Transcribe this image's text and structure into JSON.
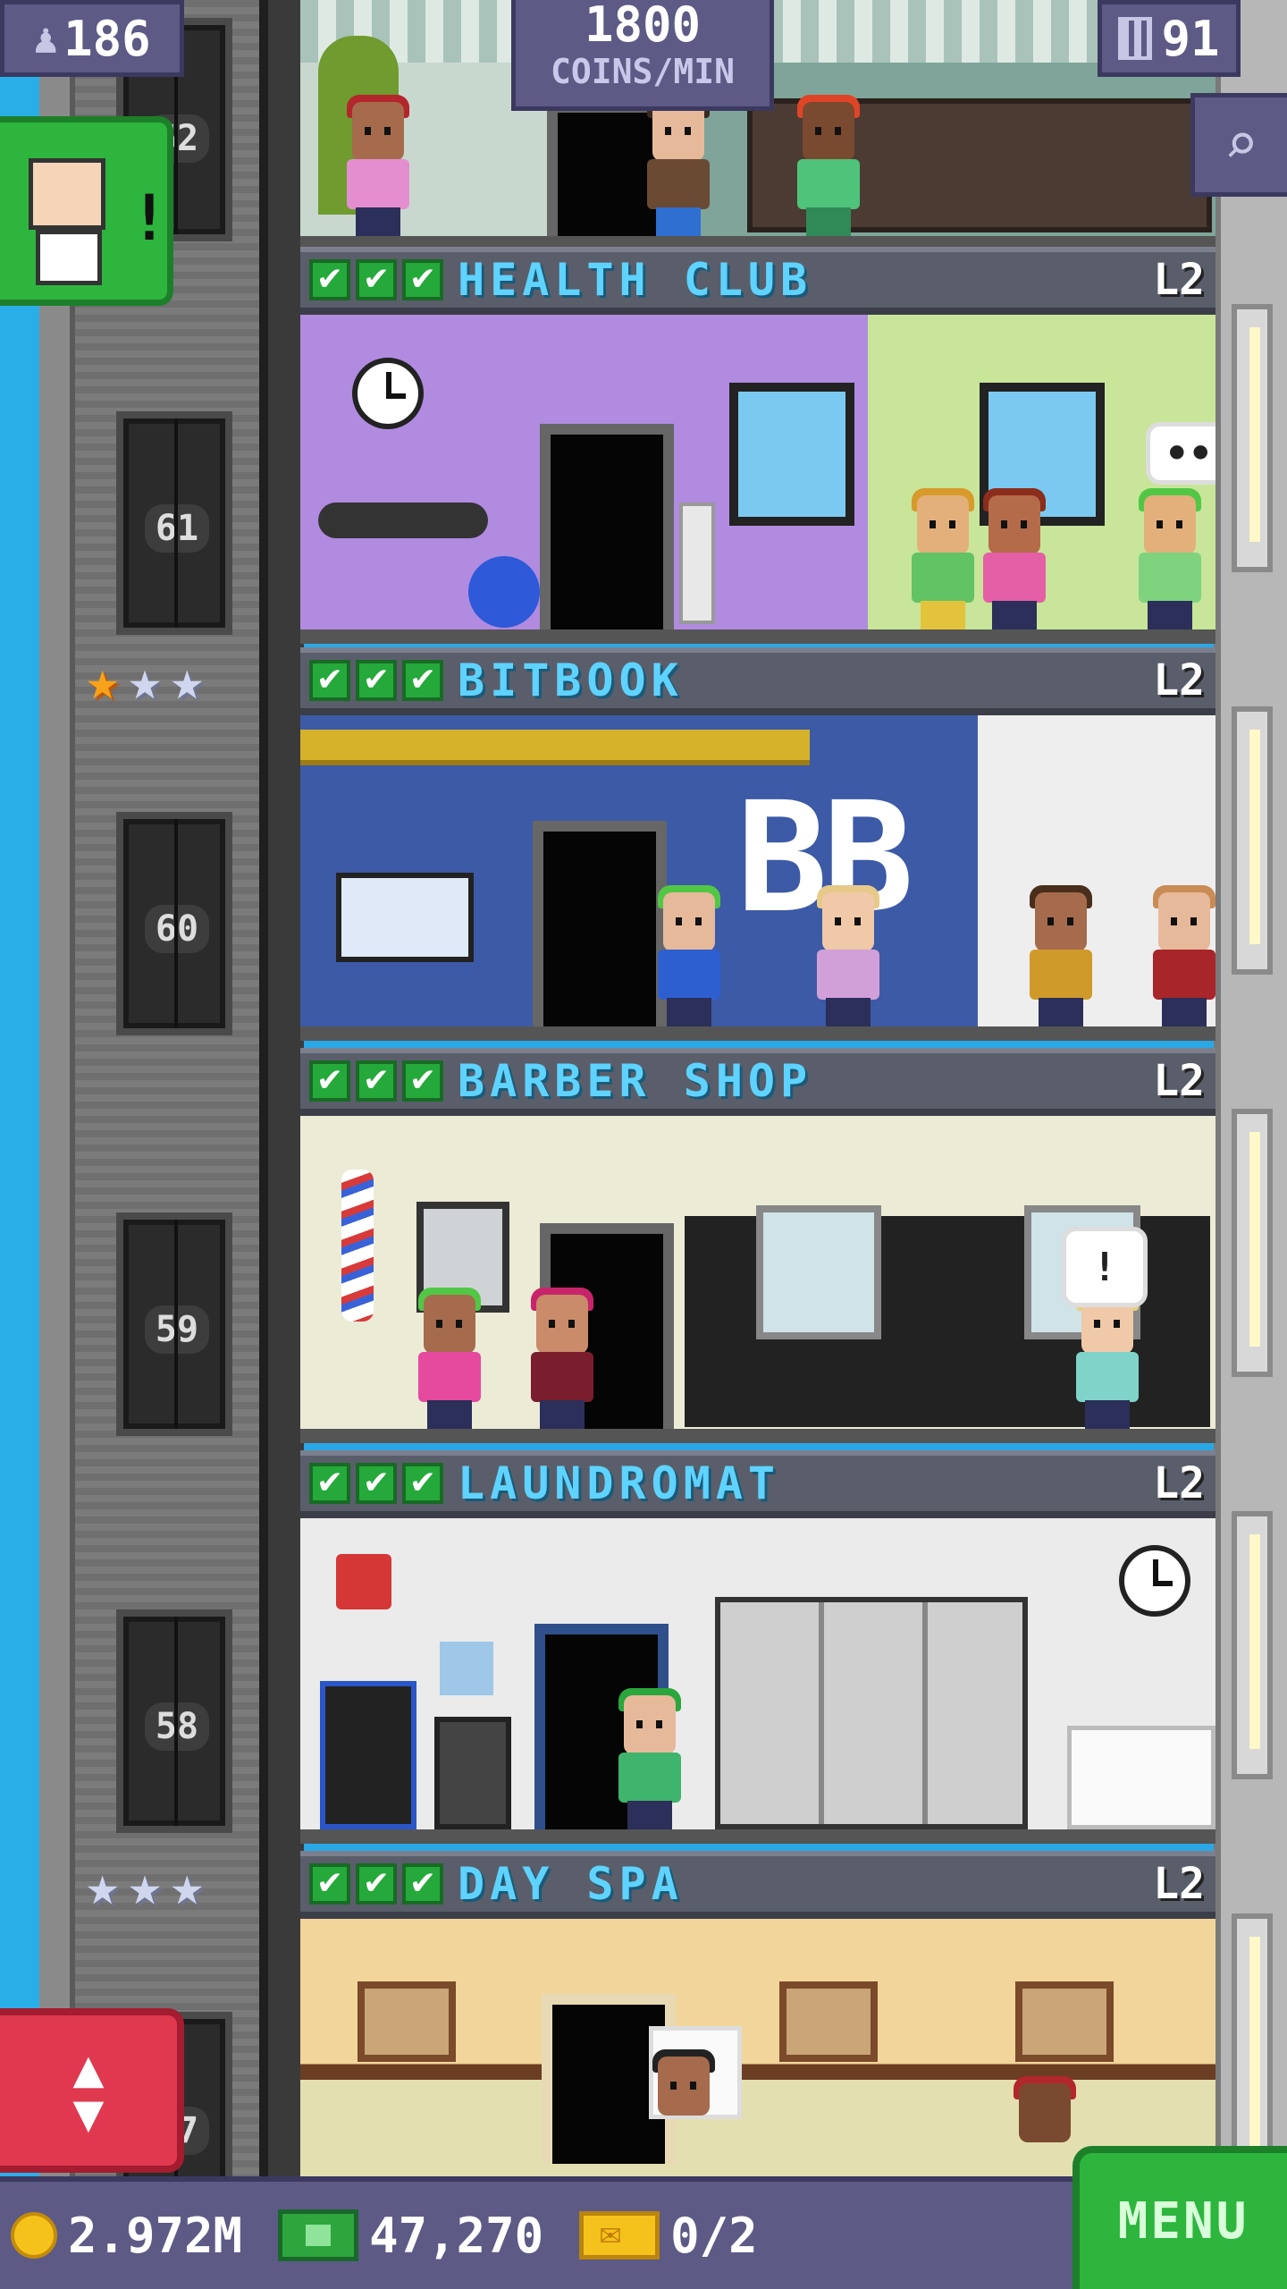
{
  "hud": {
    "population": "186",
    "coin_rate_value": "1800",
    "coin_rate_label": "COINS/MIN",
    "floors": "91"
  },
  "elevator_floor_numbers": [
    "62",
    "61",
    "60",
    "59",
    "58",
    "57"
  ],
  "floors": [
    {
      "name": "HEALTH CLUB",
      "level": "L2",
      "checks": [
        "✔",
        "✔",
        "✔"
      ]
    },
    {
      "name": "BITBOOK",
      "level": "L2",
      "checks": [
        "✔",
        "✔",
        "✔"
      ]
    },
    {
      "name": "BARBER SHOP",
      "level": "L2",
      "checks": [
        "✔",
        "✔",
        "✔"
      ]
    },
    {
      "name": "LAUNDROMAT",
      "level": "L2",
      "checks": [
        "✔",
        "✔",
        "✔"
      ]
    },
    {
      "name": "DAY SPA",
      "level": "L2",
      "checks": [
        "✔",
        "✔",
        "✔"
      ]
    }
  ],
  "bubbles": {
    "health_club": "••",
    "barber_shop": "!"
  },
  "bitbook_sign": "BB",
  "bottom": {
    "coins": "2.972M",
    "bux": "47,270",
    "tickets": "0/2",
    "menu_label": "MENU"
  },
  "colors": {
    "hud_bg": "#5d5a86",
    "accent_green": "#2db53e",
    "floor_name": "#5fd3ff",
    "elevator_button": "#e0394f"
  },
  "icons": {
    "population": "person-icon",
    "floors": "building-icon",
    "search": "magnifier-icon",
    "elevator": "up-down-arrows-icon",
    "coins": "coin-icon",
    "bux": "banknote-icon",
    "tickets": "ticket-icon"
  },
  "star_ratings": [
    {
      "floor": "BITBOOK",
      "gold": 1,
      "total": 3
    },
    {
      "floor": "DAY SPA",
      "gold": 0,
      "total": 3
    }
  ]
}
